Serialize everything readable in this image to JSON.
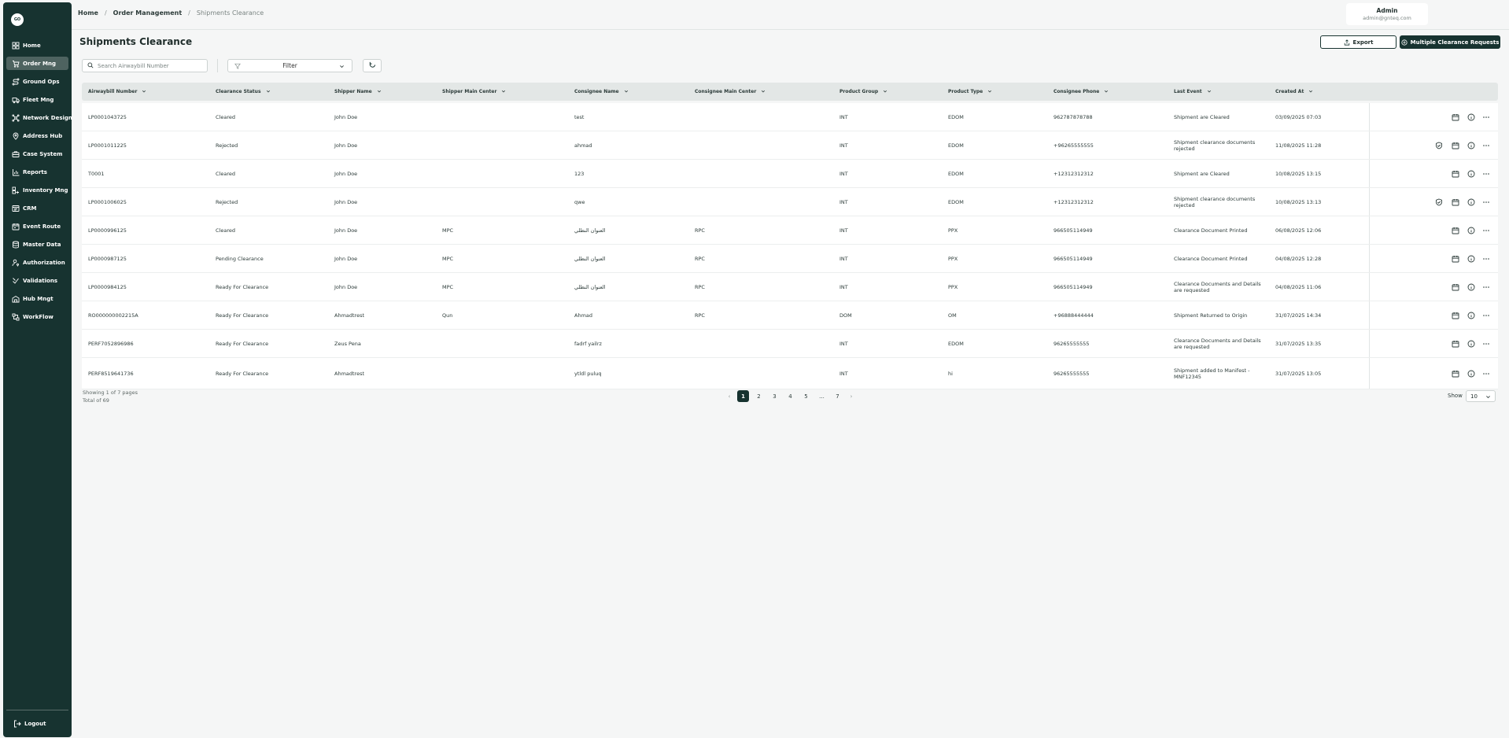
{
  "sidebar": {
    "logo": "GO",
    "items": [
      {
        "label": "Home",
        "icon": "grid-icon",
        "active": false
      },
      {
        "label": "Order Mng",
        "icon": "cart-icon",
        "active": true
      },
      {
        "label": "Ground Ops",
        "icon": "route-icon",
        "active": false
      },
      {
        "label": "Fleet Mng",
        "icon": "truck-icon",
        "active": false
      },
      {
        "label": "Network Design",
        "icon": "network-icon",
        "active": false
      },
      {
        "label": "Address Hub",
        "icon": "map-pin-icon",
        "active": false
      },
      {
        "label": "Case System",
        "icon": "briefcase-icon",
        "active": false
      },
      {
        "label": "Reports",
        "icon": "chart-icon",
        "active": false
      },
      {
        "label": "Inventory Mng",
        "icon": "inventory-icon",
        "active": false
      },
      {
        "label": "CRM",
        "icon": "crm-icon",
        "active": false
      },
      {
        "label": "Event Route",
        "icon": "event-route-icon",
        "active": false
      },
      {
        "label": "Master Data",
        "icon": "database-icon",
        "active": false
      },
      {
        "label": "Authorization",
        "icon": "user-key-icon",
        "active": false
      },
      {
        "label": "Validations",
        "icon": "check-icon",
        "active": false
      },
      {
        "label": "Hub Mngt",
        "icon": "hub-icon",
        "active": false
      },
      {
        "label": "WorkFlow",
        "icon": "workflow-icon",
        "active": false
      }
    ],
    "logout": "Logout"
  },
  "breadcrumb": {
    "home": "Home",
    "section": "Order Management",
    "current": "Shipments Clearance"
  },
  "user": {
    "name": "Admin",
    "email": "admin@gnteq.com"
  },
  "page": {
    "title": "Shipments Clearance",
    "export_label": "Export",
    "multi_label": "Multiple Clearance Requests"
  },
  "toolbar": {
    "search_placeholder": "Search Airwaybill Number",
    "filter_label": "Filter"
  },
  "table": {
    "columns": [
      "Airwaybill Number",
      "Clearance Status",
      "Shipper Name",
      "Shipper Main Center",
      "Consignee Name",
      "Consignee Main Center",
      "Product Group",
      "Product Type",
      "Consignee Phone",
      "Last Event",
      "Created At"
    ],
    "rows": [
      [
        "LP0001043725",
        "Cleared",
        "John Doe",
        "",
        "test",
        "",
        "INT",
        "EDOM",
        "962787878788",
        "Shipment are Cleared",
        "03/09/2025 07:03"
      ],
      [
        "LP0001011225",
        "Rejected",
        "John Doe",
        "",
        "ahmad",
        "",
        "INT",
        "EDOM",
        "+96265555555",
        "Shipment clearance documents rejected",
        "11/08/2025 11:28"
      ],
      [
        "T0001",
        "Cleared",
        "John Doe",
        "",
        "123",
        "",
        "INT",
        "EDOM",
        "+12312312312",
        "Shipment are Cleared",
        "10/08/2025 13:15"
      ],
      [
        "LP0001006025",
        "Rejected",
        "John Doe",
        "",
        "qwe",
        "",
        "INT",
        "EDOM",
        "+12312312312",
        "Shipment clearance documents rejected",
        "10/08/2025 13:13"
      ],
      [
        "LP0000996125",
        "Cleared",
        "John Doe",
        "MPC",
        "العنوان النظلي",
        "RPC",
        "INT",
        "PPX",
        "966505114949",
        "Clearance Document Printed",
        "06/08/2025 12:06"
      ],
      [
        "LP0000987125",
        "Pending Clearance",
        "John Doe",
        "MPC",
        "العنوان النظلي",
        "RPC",
        "INT",
        "PPX",
        "966505114949",
        "Clearance Document Printed",
        "04/08/2025 12:28"
      ],
      [
        "LP0000984125",
        "Ready For Clearance",
        "John Doe",
        "MPC",
        "العنوان النظلي",
        "RPC",
        "INT",
        "PPX",
        "966505114949",
        "Clearance Documents and Details are requested",
        "04/08/2025 11:06"
      ],
      [
        "RO000000002215A",
        "Ready For Clearance",
        "Ahmadtrest",
        "Qun",
        "Ahmad",
        "RPC",
        "DOM",
        "OM",
        "+96888444444",
        "Shipment Returned to Origin",
        "31/07/2025 14:34"
      ],
      [
        "PERF7052896986",
        "Ready For Clearance",
        "Zeus Pena",
        "",
        "fadrf yailrz",
        "",
        "INT",
        "EDOM",
        "96265555555",
        "Clearance Documents and Details are requested",
        "31/07/2025 13:35"
      ],
      [
        "PERF8519641736",
        "Ready For Clearance",
        "Ahmadtrest",
        "",
        "ytldl puluq",
        "",
        "INT",
        "hi",
        "96265555555",
        "Shipment added to Manifest - MNF12345",
        "31/07/2025 13:05"
      ]
    ]
  },
  "pagination": {
    "showing": "Showing 1 of 7 pages",
    "total": "Total of 69",
    "pages": [
      "1",
      "2",
      "3",
      "4",
      "5",
      "...",
      "7"
    ],
    "active_page": "1",
    "prev": "‹",
    "next": "›",
    "show_label": "Show",
    "page_size": "10"
  },
  "colors": {
    "sidebar": "#173330",
    "primary": "#173330",
    "active_nav": "#4e6360"
  }
}
